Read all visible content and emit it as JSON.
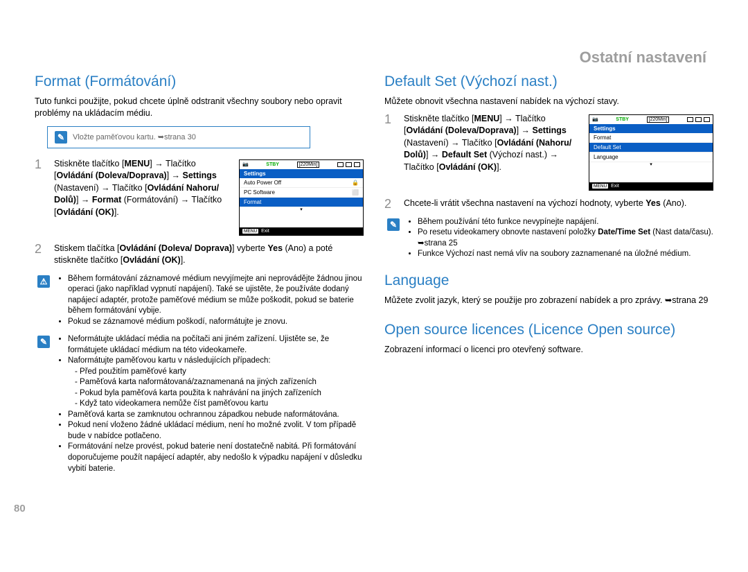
{
  "chapter": "Ostatní nastavení",
  "page_number": "80",
  "left": {
    "h_format": "Format (Formátování)",
    "intro": "Tuto funkci použijte, pokud chcete úplně odstranit všechny soubory nebo opravit problémy na ukládacím médiu.",
    "note": "Vložte paměťovou kartu. ➥strana 30",
    "step1": "Stiskněte tlačítko [MENU] → Tlačítko [Ovládání (Doleva/Doprava)] → Settings (Nastavení) → Tlačítko [Ovládání Nahoru/ Dolů)] → Format (Formátování) → Tlačítko [Ovládání (OK)].",
    "step2": "Stiskem tlačítka [Ovládání (Doleva/ Doprava)] vyberte Yes (Ano) a poté stiskněte tlačítko [Ovládání (OK)].",
    "warn": [
      "Během formátování záznamové médium nevyjímejte ani neprovádějte žádnou jinou operaci (jako například vypnutí napájení). Také se ujistěte, že používáte dodaný napájecí adaptér, protože paměťové médium se může poškodit, pokud se baterie během formátování vybije.",
      "Pokud se záznamové médium poškodí, naformátujte je znovu."
    ],
    "tips": [
      "Neformátujte ukládací média na počítači ani jiném zařízení. Ujistěte se, že formátujete ukládací médium na této videokameře.",
      "Naformátujte paměťovou kartu v následujících případech:",
      "Paměťová karta se zamknutou ochrannou západkou nebude naformátována.",
      "Pokud není vloženo žádné ukládací médium, není ho možné zvolit. V tom případě bude v nabídce potlačeno.",
      "Formátování nelze provést, pokud baterie není dostatečně nabitá. Při formátování doporučujeme použít napájecí adaptér, aby nedošlo k výpadku napájení v důsledku vybití baterie."
    ],
    "tips_sub": [
      "Před použitím paměťové karty",
      "Paměťová karta naformátovaná/zaznamenaná na jiných zařízeních",
      "Pokud byla paměťová karta použita k nahrávání na jiných zařízeních",
      "Když tato videokamera nemůže číst paměťovou kartu"
    ]
  },
  "right": {
    "h_default": "Default Set (Výchozí nast.)",
    "default_intro": "Můžete obnovit všechna nastavení nabídek na výchozí stavy.",
    "step1": "Stiskněte tlačítko [MENU] → Tlačítko [Ovládání (Doleva/Doprava)] → Settings (Nastavení) → Tlačítko [Ovládání (Nahoru/ Dolů)] → Default Set (Výchozí nast.) → Tlačítko [Ovládání (OK)].",
    "step2": "Chcete-li vrátit všechna nastavení na výchozí hodnoty, vyberte Yes (Ano).",
    "tips": [
      "Během používání této funkce nevypínejte napájení.",
      "Po resetu videokamery obnovte nastavení položky Date/Time Set (Nast data/času). ➥strana 25",
      "Funkce Výchozí nast nemá vliv na soubory zaznamenané na úložné médium."
    ],
    "h_lang": "Language",
    "lang_body": "Můžete zvolit jazyk, který se použije pro zobrazení nabídek a pro zprávy. ➥strana 29",
    "h_open": "Open source licences (Licence Open source)",
    "open_body": "Zobrazení informací o licenci pro otevřený software."
  },
  "lcd_left": {
    "stby": "STBY",
    "time": "[220Min]",
    "head": "Settings",
    "items": [
      "Auto Power Off",
      "PC Software",
      "Format"
    ],
    "selected": "Format",
    "exit": "Exit",
    "menu": "MENU"
  },
  "lcd_right": {
    "stby": "STBY",
    "time": "[220Min]",
    "head": "Settings",
    "items": [
      "Format",
      "Default Set",
      "Language"
    ],
    "selected": "Default Set",
    "exit": "Exit",
    "menu": "MENU"
  }
}
